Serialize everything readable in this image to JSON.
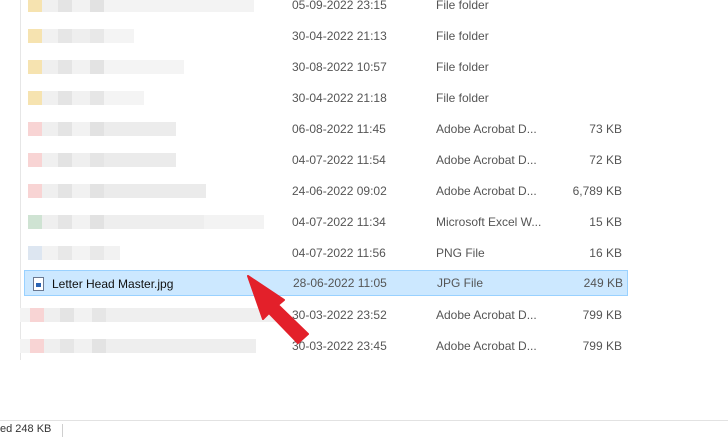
{
  "rows": [
    {
      "date": "05-09-2022 23:15",
      "type": "File folder",
      "size": ""
    },
    {
      "date": "30-04-2022 21:13",
      "type": "File folder",
      "size": ""
    },
    {
      "date": "30-08-2022 10:57",
      "type": "File folder",
      "size": ""
    },
    {
      "date": "30-04-2022 21:18",
      "type": "File folder",
      "size": ""
    },
    {
      "date": "06-08-2022 11:45",
      "type": "Adobe Acrobat D...",
      "size": "73 KB"
    },
    {
      "date": "04-07-2022 11:54",
      "type": "Adobe Acrobat D...",
      "size": "72 KB"
    },
    {
      "date": "24-06-2022 09:02",
      "type": "Adobe Acrobat D...",
      "size": "6,789 KB"
    },
    {
      "date": "04-07-2022 11:34",
      "type": "Microsoft Excel W...",
      "size": "15 KB"
    },
    {
      "date": "04-07-2022 11:56",
      "type": "PNG File",
      "size": "16 KB"
    },
    {
      "name": "Letter Head Master.jpg",
      "date": "28-06-2022 11:05",
      "type": "JPG File",
      "size": "249 KB"
    },
    {
      "date": "30-03-2022 23:52",
      "type": "Adobe Acrobat D...",
      "size": "799 KB"
    },
    {
      "date": "30-03-2022 23:45",
      "type": "Adobe Acrobat D...",
      "size": "799 KB"
    }
  ],
  "statusbar": {
    "text": "ed  248 KB"
  },
  "colors": {
    "selection": "#cce8ff",
    "selection_border": "#99d1ff",
    "arrow": "#e3202a"
  },
  "icons": {
    "selected_file": "jpg-file-icon"
  }
}
